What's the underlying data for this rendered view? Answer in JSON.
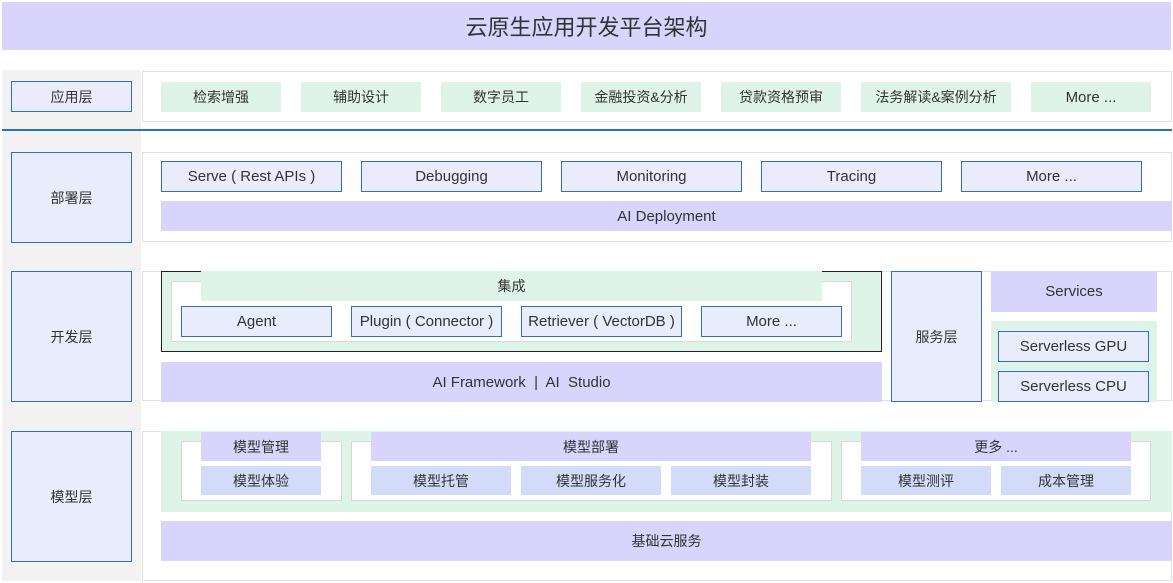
{
  "title": "云原生应用开发平台架构",
  "layers": {
    "app": "应用层",
    "deploy": "部署层",
    "dev": "开发层",
    "model": "模型层"
  },
  "app_items": [
    "检索增强",
    "辅助设计",
    "数字员工",
    "金融投资&分析",
    "贷款资格预审",
    "法务解读&案例分析",
    "More ..."
  ],
  "deploy": {
    "items": [
      "Serve ( Rest APIs )",
      "Debugging",
      "Monitoring",
      "Tracing",
      "More ..."
    ],
    "bar": "AI Deployment"
  },
  "dev": {
    "integration": "集成",
    "items": [
      "Agent",
      "Plugin ( Connector )",
      "Retriever ( VectorDB )",
      "More ..."
    ],
    "framework": "AI Framework  |  AI  Studio",
    "service_layer": "服务层",
    "services": "Services",
    "serverless_gpu": "Serverless GPU",
    "serverless_cpu": "Serverless CPU"
  },
  "model": {
    "mgmt_title": "模型管理",
    "mgmt_item": "模型体验",
    "deploy_title": "模型部署",
    "deploy_items": [
      "模型托管",
      "模型服务化",
      "模型封装"
    ],
    "more_title": "更多 ...",
    "more_items": [
      "模型测评",
      "成本管理"
    ],
    "cloud": "基础云服务"
  },
  "colors": {
    "title_purple": "#d9d4fb",
    "label_blue": "#e8ecfb",
    "border_blue": "#2e6fbf",
    "green": "#dff4e8",
    "light_blue": "#d2dcf8"
  }
}
